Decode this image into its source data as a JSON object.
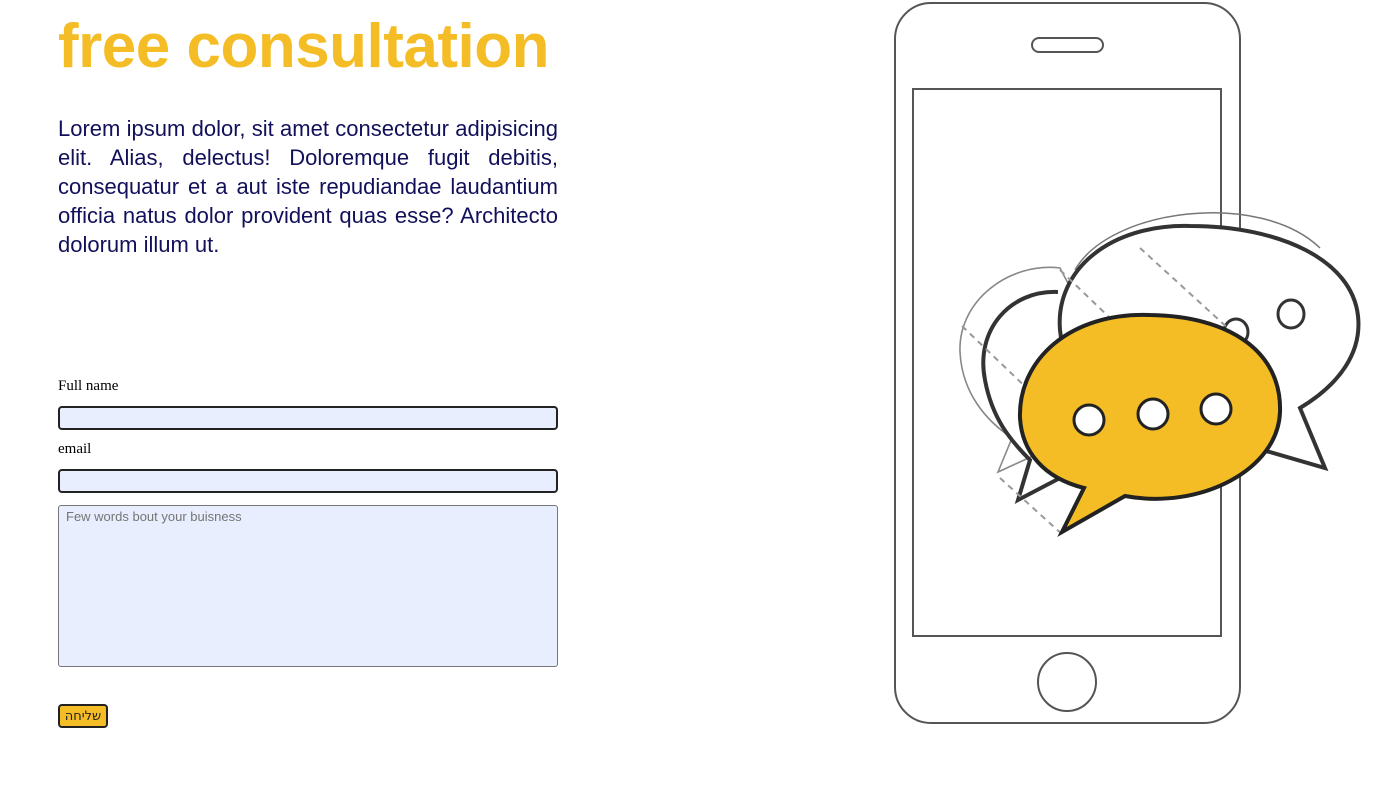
{
  "hero": {
    "title": "free consultation",
    "description": "Lorem ipsum dolor, sit amet consectetur adipisicing elit. Alias, delectus! Doloremque fugit debitis, consequatur et a aut iste repudiandae laudantium officia natus dolor provident quas esse? Architecto dolorum illum ut."
  },
  "form": {
    "fullname_label": "Full name",
    "fullname_value": "",
    "email_label": "email",
    "email_value": "",
    "message_placeholder": "Few words bout your buisness",
    "submit_label": "שליחה"
  },
  "illustration": {
    "icon": "phone-chat-bubbles-illustration",
    "accent_color": "#f4bd26"
  },
  "colors": {
    "title": "#f4bd26",
    "text": "#12105a",
    "input_bg": "#e8eefd"
  }
}
